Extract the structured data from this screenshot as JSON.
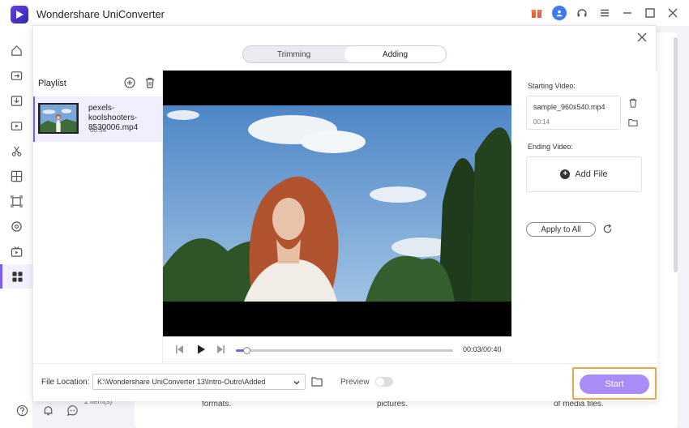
{
  "app": {
    "title": "Wondershare UniConverter"
  },
  "modal": {
    "tabs": [
      {
        "label": "Trimming"
      },
      {
        "label": "Adding"
      }
    ]
  },
  "playlist": {
    "title": "Playlist",
    "items": [
      {
        "name": "pexels-koolshooters-8530006.mp4",
        "duration": "00:54"
      }
    ],
    "count": "1 item(s)"
  },
  "player": {
    "timecode": "00:03/00:40",
    "progress": 0.05
  },
  "right_panel": {
    "starting_label": "Starting Video:",
    "starting_file": "sample_960x540.mp4",
    "starting_duration": "00:14",
    "ending_label": "Ending Video:",
    "add_file_label": "Add File",
    "apply_all_label": "Apply to All"
  },
  "bottom": {
    "file_location_label": "File Location:",
    "file_location_value": "K:\\Wondershare UniConverter 13\\Intro-Outro\\Added",
    "preview_label": "Preview",
    "preview_on": false,
    "start_label": "Start"
  },
  "background": {
    "snippets": [
      "formats.",
      "pictures.",
      "of media files."
    ]
  },
  "colors": {
    "accent": "#7b5cf5",
    "start_button": "#a98cf6",
    "highlight_border": "#f0a44a"
  }
}
